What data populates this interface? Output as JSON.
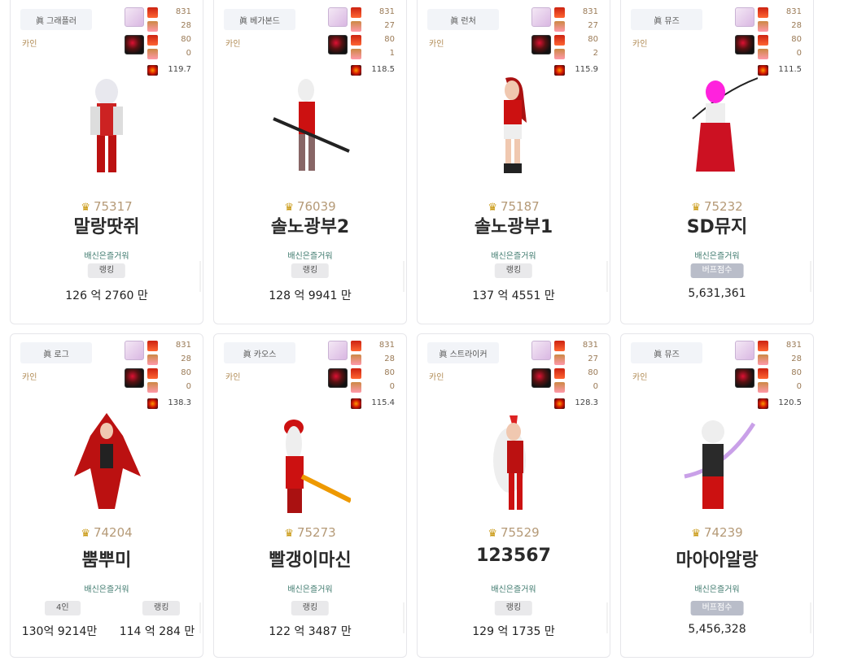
{
  "cards": [
    {
      "job": "眞 그래플러",
      "server": "카인",
      "n": [
        "831",
        "28",
        "80",
        "0",
        "119.7"
      ],
      "score": "75317",
      "name": "말랑땃쥐",
      "adventure": "배신은즐거워",
      "tag": "랭킹",
      "value": "126 억 2760 만",
      "buff": false
    },
    {
      "job": "眞 베가본드",
      "server": "카인",
      "n": [
        "831",
        "27",
        "80",
        "1",
        "118.5"
      ],
      "score": "76039",
      "name": "솔노광부2",
      "adventure": "배신은즐거워",
      "tag": "랭킹",
      "value": "128 억 9941 만",
      "buff": false
    },
    {
      "job": "眞 런처",
      "server": "카인",
      "n": [
        "831",
        "27",
        "80",
        "2",
        "115.9"
      ],
      "score": "75187",
      "name": "솔노광부1",
      "adventure": "배신은즐거워",
      "tag": "랭킹",
      "value": "137 억 4551 만",
      "buff": false
    },
    {
      "job": "眞 뮤즈",
      "server": "카인",
      "n": [
        "831",
        "28",
        "80",
        "0",
        "111.5"
      ],
      "score": "75232",
      "name": "SD뮤지",
      "adventure": "배신은즐거워",
      "tag": "버프점수",
      "value": "5,631,361",
      "buff": true
    },
    {
      "job": "眞 로그",
      "server": "카인",
      "n": [
        "831",
        "28",
        "80",
        "0",
        "138.3"
      ],
      "score": "74204",
      "name": "뿜뿌미",
      "adventure": "배신은즐거워",
      "tag": "4인",
      "value": "130억 9214만",
      "tag2": "랭킹",
      "value2": "114 억 284 만",
      "buff": false
    },
    {
      "job": "眞 카오스",
      "server": "카인",
      "n": [
        "831",
        "28",
        "80",
        "0",
        "115.4"
      ],
      "score": "75273",
      "name": "빨갱이마신",
      "adventure": "배신은즐거워",
      "tag": "랭킹",
      "value": "122 억 3487 만",
      "buff": false
    },
    {
      "job": "眞 스트라이커",
      "server": "카인",
      "n": [
        "831",
        "27",
        "80",
        "0",
        "128.3"
      ],
      "score": "75529",
      "name": "123567",
      "adventure": "배신은즐거워",
      "tag": "랭킹",
      "value": "129 억 1735 만",
      "buff": false
    },
    {
      "job": "眞 뮤즈",
      "server": "카인",
      "n": [
        "831",
        "28",
        "80",
        "0",
        "120.5"
      ],
      "score": "74239",
      "name": "마아아알랑",
      "adventure": "배신은즐거워",
      "tag": "버프점수",
      "value": "5,456,328",
      "buff": true
    }
  ]
}
